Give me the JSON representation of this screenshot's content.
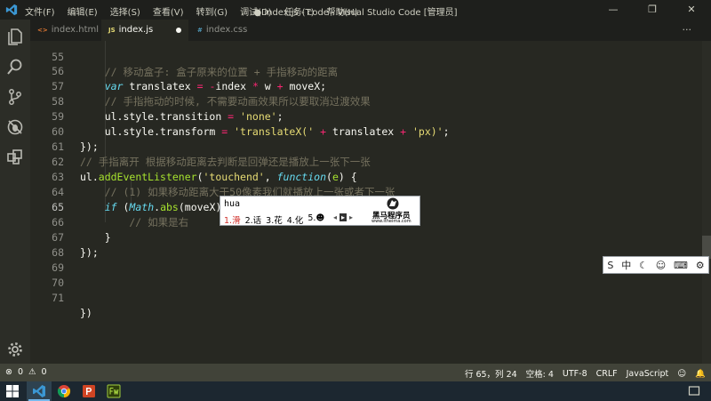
{
  "window": {
    "title": "● index.js - code - Visual Studio Code [管理员]",
    "menu": [
      "文件(F)",
      "编辑(E)",
      "选择(S)",
      "查看(V)",
      "转到(G)",
      "调试(D)",
      "任务(T)",
      "帮助(H)"
    ],
    "controls": [
      "—",
      "❐",
      "✕"
    ]
  },
  "tabs": [
    {
      "label": "index.html",
      "icon": "html-file-icon",
      "icon_glyph": "<>",
      "icon_color": "#e37933"
    },
    {
      "label": "index.js",
      "icon": "js-file-icon",
      "icon_glyph": "JS",
      "icon_color": "#e6db74",
      "modified": true
    },
    {
      "label": "index.css",
      "icon": "css-file-icon",
      "icon_glyph": "#",
      "icon_color": "#519aba"
    }
  ],
  "tab_overflow": "···",
  "editor": {
    "lines": [
      {
        "n": "55",
        "code": "    // 移动盒子: 盒子原来的位置 + 手指移动的距离"
      },
      {
        "n": "56",
        "code": "    var translatex = -index * w + moveX;"
      },
      {
        "n": "57",
        "code": "    // 手指拖动的时候, 不需要动画效果所以要取消过渡效果"
      },
      {
        "n": "58",
        "code": "    ul.style.transition = 'none';"
      },
      {
        "n": "59",
        "code": "    ul.style.transform = 'translateX(' + translatex + 'px)';"
      },
      {
        "n": "60",
        "code": "});"
      },
      {
        "n": "61",
        "code": "// 手指离开 根据移动距离去判断是回弹还是播放上一张下一张"
      },
      {
        "n": "62",
        "code": "ul.addEventListener('touchend', function(e) {"
      },
      {
        "n": "63",
        "code": "    // (1) 如果移动距离大于50像素我们就播放上一张或者下一张"
      },
      {
        "n": "64",
        "code": "    if (Math.abs(moveX) > 50) {"
      },
      {
        "n": "65",
        "code": "        // 如果是右"
      },
      {
        "n": "66",
        "code": "    }"
      },
      {
        "n": "67",
        "code": "});"
      },
      {
        "n": "68",
        "code": ""
      },
      {
        "n": "69",
        "code": ""
      },
      {
        "n": "70",
        "code": ""
      },
      {
        "n": "71",
        "code": "})"
      }
    ]
  },
  "ime_popup": {
    "composition": "hua",
    "candidates": [
      "1.滑",
      "2.话",
      "3.花",
      "4.化",
      "5.☻"
    ],
    "nav": [
      "◂",
      "▸",
      "▸"
    ],
    "brand_name": "黑马程序员",
    "brand_url": "www.itheima.com"
  },
  "ime_toolbar": [
    "S",
    "中",
    "☾",
    "☺",
    "⌨",
    "⚙"
  ],
  "status": {
    "errors": "0",
    "warnings": "0",
    "position": "行 65，列 24",
    "spaces": "空格: 4",
    "encoding": "UTF-8",
    "eol": "CRLF",
    "language": "JavaScript",
    "feedback": "☺",
    "bell": "🔔"
  },
  "taskbar": [
    {
      "name": "windows-start-icon"
    },
    {
      "name": "vscode-icon",
      "active": true
    },
    {
      "name": "chrome-icon"
    },
    {
      "name": "powerpoint-icon"
    },
    {
      "name": "fireworks-icon"
    }
  ],
  "colors": {
    "editor_bg": "#272822",
    "status_bg": "#414339",
    "accent": "#66d9ef"
  }
}
